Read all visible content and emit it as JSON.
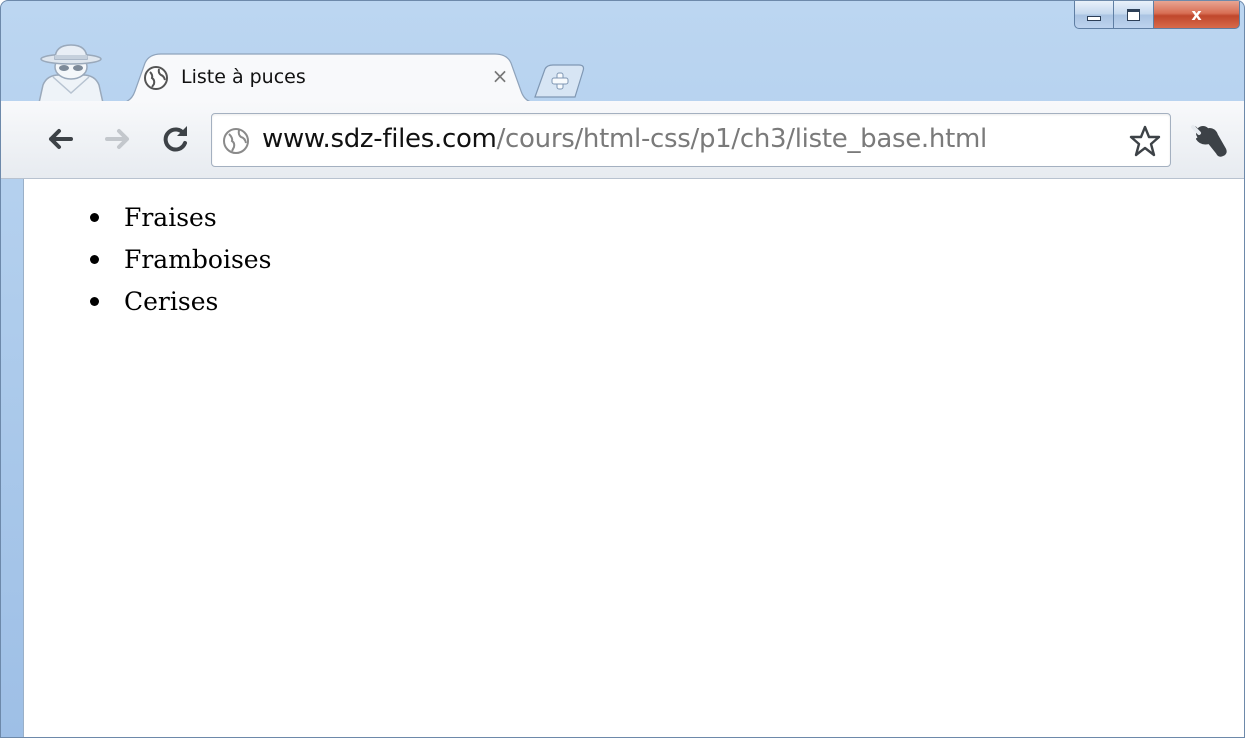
{
  "window": {
    "controls": {
      "close_label": "x"
    }
  },
  "tab": {
    "title": "Liste à puces",
    "close_label": "×"
  },
  "omnibox": {
    "url_host": "www.sdz-files.com",
    "url_path": "/cours/html-css/p1/ch3/liste_base.html"
  },
  "page": {
    "items": [
      "Fraises",
      "Framboises",
      "Cerises"
    ]
  },
  "colors": {
    "frame": "#a9c8ea",
    "close_button": "#c0472c",
    "url_host": "#111111",
    "url_path": "#7a7a7a"
  },
  "icons": {
    "incognito": "incognito-icon",
    "favicon": "globe-icon",
    "new_tab": "new-tab-icon",
    "back": "back-arrow-icon",
    "forward": "forward-arrow-icon",
    "reload": "reload-icon",
    "star": "star-icon",
    "wrench": "wrench-icon"
  }
}
